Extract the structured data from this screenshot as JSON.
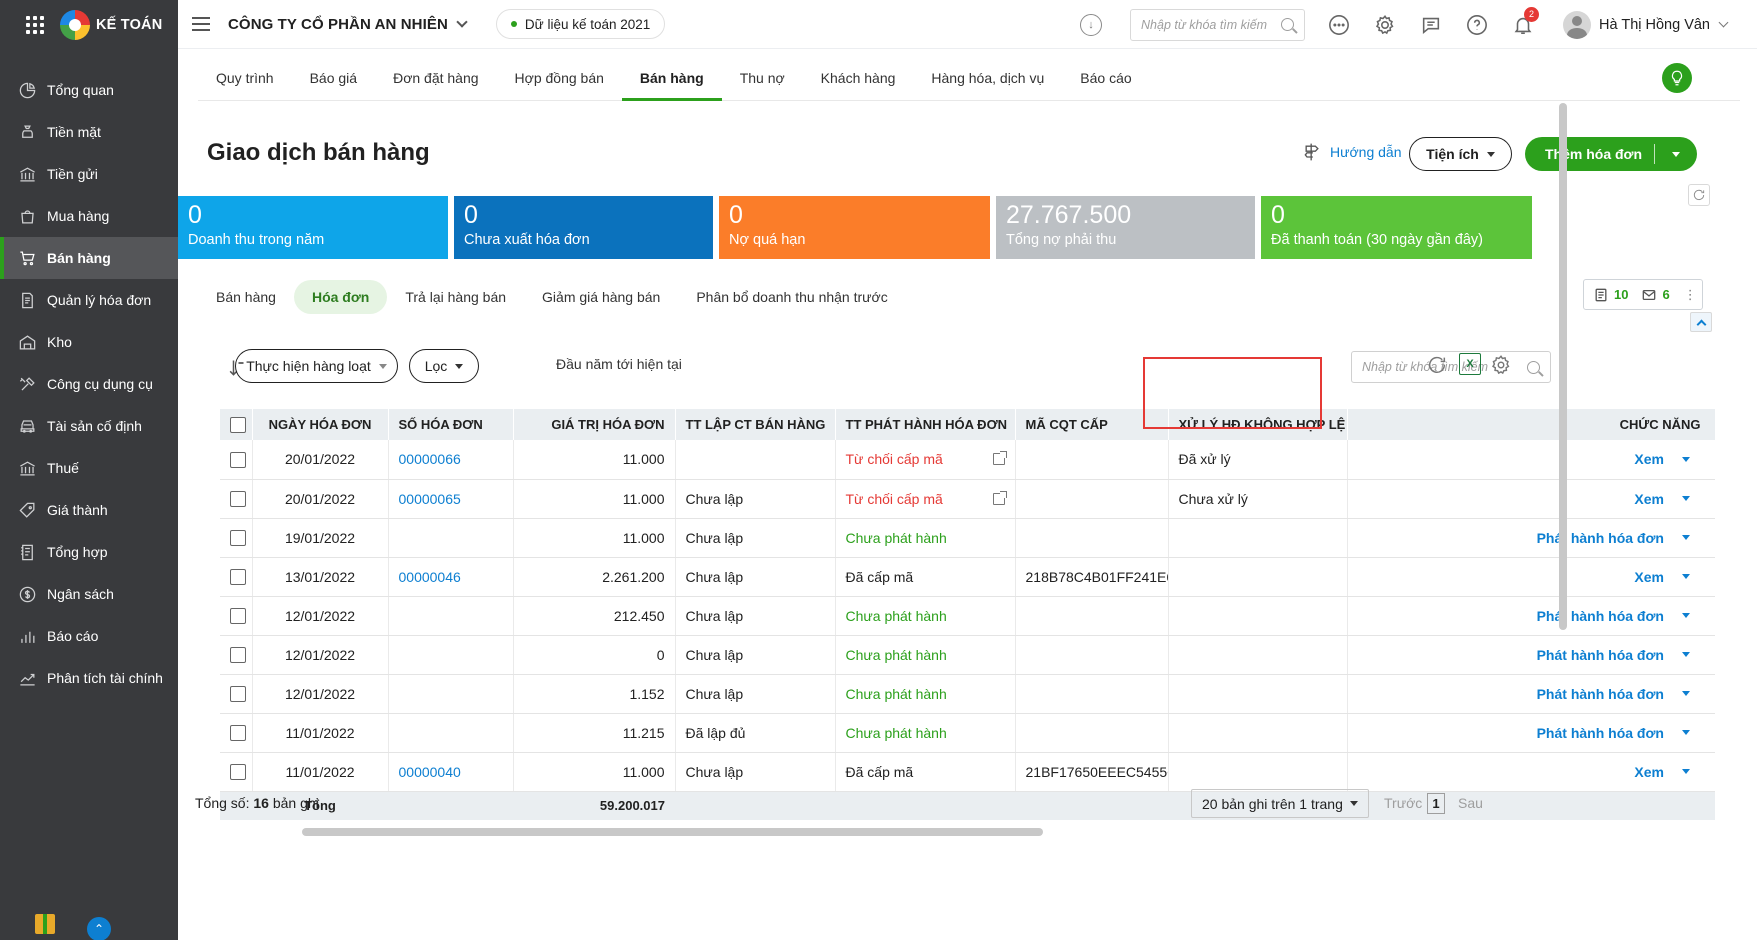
{
  "brand": {
    "name": "KẾ TOÁN"
  },
  "sidebar": {
    "items": [
      {
        "label": "Tổng quan",
        "icon": "pie-chart-icon"
      },
      {
        "label": "Tiền mặt",
        "icon": "money-bag-icon"
      },
      {
        "label": "Tiền gửi",
        "icon": "bank-icon"
      },
      {
        "label": "Mua hàng",
        "icon": "shopping-bag-icon"
      },
      {
        "label": "Bán hàng",
        "icon": "cart-icon",
        "active": true
      },
      {
        "label": "Quản lý hóa đơn",
        "icon": "invoice-icon"
      },
      {
        "label": "Kho",
        "icon": "warehouse-icon"
      },
      {
        "label": "Công cụ dụng cụ",
        "icon": "tools-icon"
      },
      {
        "label": "Tài sản cố định",
        "icon": "car-icon"
      },
      {
        "label": "Thuế",
        "icon": "tax-icon"
      },
      {
        "label": "Giá thành",
        "icon": "price-tag-icon"
      },
      {
        "label": "Tổng hợp",
        "icon": "ledger-icon"
      },
      {
        "label": "Ngân sách",
        "icon": "budget-icon"
      },
      {
        "label": "Báo cáo",
        "icon": "bar-chart-icon"
      },
      {
        "label": "Phân tích tài chính",
        "icon": "analytics-icon"
      }
    ]
  },
  "header": {
    "company": "CÔNG TY CỔ PHẦN AN NHIÊN",
    "dataset": "Dữ liệu kế toán 2021",
    "search_placeholder": "Nhập từ khóa tìm kiếm",
    "notification_count": "2",
    "user_name": "Hà Thị Hồng Vân"
  },
  "main_tabs": [
    "Quy trình",
    "Báo giá",
    "Đơn đặt hàng",
    "Hợp đồng bán",
    "Bán hàng",
    "Thu nợ",
    "Khách hàng",
    "Hàng hóa, dịch vụ",
    "Báo cáo"
  ],
  "main_tab_active": 4,
  "page": {
    "title": "Giao dịch bán hàng",
    "guide": "Hướng dẫn",
    "utilities": "Tiện ích",
    "add_invoice": "Thêm hóa đơn"
  },
  "kpis": [
    {
      "value": "0",
      "label": "Doanh thu trong năm",
      "color": "#0ea5e9"
    },
    {
      "value": "0",
      "label": "Chưa xuất hóa đơn",
      "color": "#0b72bd"
    },
    {
      "value": "0",
      "label": "Nợ quá hạn",
      "color": "#fb7d29"
    },
    {
      "value": "27.767.500",
      "label": "Tổng nợ phải thu",
      "color": "#bcc0c4"
    },
    {
      "value": "0",
      "label": "Đã thanh toán (30 ngày gần đây)",
      "color": "#5cc43a"
    }
  ],
  "sub_tabs": [
    "Bán hàng",
    "Hóa đơn",
    "Trả lại hàng bán",
    "Giảm giá hàng bán",
    "Phân bổ doanh thu nhận trước"
  ],
  "sub_tab_active": 1,
  "counters": {
    "docs": "10",
    "mails": "6"
  },
  "toolbar": {
    "bulk_action": "Thực hiện hàng loạt",
    "filter": "Lọc",
    "period": "Đầu năm tới hiện tại",
    "search_placeholder": "Nhập từ khóa tìm kiếm"
  },
  "table": {
    "columns": [
      "NGÀY HÓA ĐƠN",
      "SỐ HÓA ĐƠN",
      "GIÁ TRỊ HÓA ĐƠN",
      "TT LẬP CT BÁN HÀNG",
      "TT PHÁT HÀNH HÓA ĐƠN",
      "MÃ CQT CẤP",
      "XỬ LÝ HĐ KHÔNG HỢP LỆ",
      "CHỨC NĂNG"
    ],
    "rows": [
      {
        "date": "20/01/2022",
        "number": "00000066",
        "amount": "11.000",
        "sales_status": "",
        "issue_status": "Từ chối cấp mã",
        "issue_color": "red",
        "ext": true,
        "tax_code": "",
        "handling": "Đã xử lý",
        "action": "Xem"
      },
      {
        "date": "20/01/2022",
        "number": "00000065",
        "amount": "11.000",
        "sales_status": "Chưa lập",
        "issue_status": "Từ chối cấp mã",
        "issue_color": "red",
        "ext": true,
        "tax_code": "",
        "handling": "Chưa xử lý",
        "action": "Xem"
      },
      {
        "date": "19/01/2022",
        "number": "",
        "amount": "11.000",
        "sales_status": "Chưa lập",
        "issue_status": "Chưa phát hành",
        "issue_color": "green",
        "ext": false,
        "tax_code": "",
        "handling": "",
        "action": "Phát hành hóa đơn"
      },
      {
        "date": "13/01/2022",
        "number": "00000046",
        "amount": "2.261.200",
        "sales_status": "Chưa lập",
        "issue_status": "Đã cấp mã",
        "issue_color": "black",
        "ext": false,
        "tax_code": "218B78C4B01FF241E6...",
        "handling": "",
        "action": "Xem"
      },
      {
        "date": "12/01/2022",
        "number": "",
        "amount": "212.450",
        "sales_status": "Chưa lập",
        "issue_status": "Chưa phát hành",
        "issue_color": "green",
        "ext": false,
        "tax_code": "",
        "handling": "",
        "action": "Phát hành hóa đơn"
      },
      {
        "date": "12/01/2022",
        "number": "",
        "amount": "0",
        "sales_status": "Chưa lập",
        "issue_status": "Chưa phát hành",
        "issue_color": "green",
        "ext": false,
        "tax_code": "",
        "handling": "",
        "action": "Phát hành hóa đơn"
      },
      {
        "date": "12/01/2022",
        "number": "",
        "amount": "1.152",
        "sales_status": "Chưa lập",
        "issue_status": "Chưa phát hành",
        "issue_color": "green",
        "ext": false,
        "tax_code": "",
        "handling": "",
        "action": "Phát hành hóa đơn"
      },
      {
        "date": "11/01/2022",
        "number": "",
        "amount": "11.215",
        "sales_status": "Đã lập đủ",
        "issue_status": "Chưa phát hành",
        "issue_color": "green",
        "ext": false,
        "tax_code": "",
        "handling": "",
        "action": "Phát hành hóa đơn"
      },
      {
        "date": "11/01/2022",
        "number": "00000040",
        "amount": "11.000",
        "sales_status": "Chưa lập",
        "issue_status": "Đã cấp mã",
        "issue_color": "black",
        "ext": false,
        "tax_code": "21BF17650EEEC5455C...",
        "handling": "",
        "action": "Xem"
      }
    ],
    "total_label": "Tổng",
    "total_amount": "59.200.017"
  },
  "footer": {
    "count_prefix": "Tổng số: ",
    "count": "16",
    "count_suffix": " bản ghi",
    "page_size": "20 bản ghi trên 1 trang",
    "prev": "Trước",
    "page": "1",
    "next": "Sau"
  }
}
